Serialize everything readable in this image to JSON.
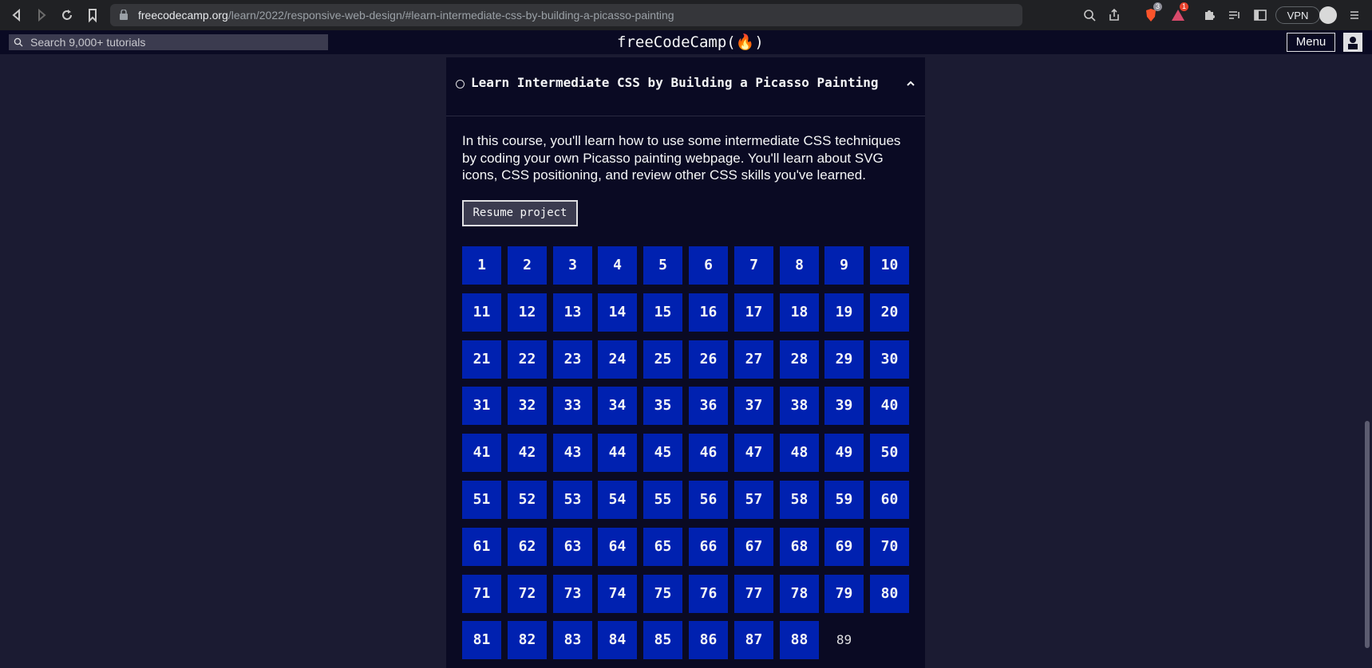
{
  "browser": {
    "url_host": "freecodecamp.org",
    "url_path": "/learn/2022/responsive-web-design/#learn-intermediate-css-by-building-a-picasso-painting",
    "brave_badge": "3",
    "alert_badge": "1",
    "vpn_label": "VPN"
  },
  "navbar": {
    "search_placeholder": "Search 9,000+ tutorials",
    "logo": "freeCodeCamp(🔥)",
    "menu_label": "Menu"
  },
  "block": {
    "title": "Learn Intermediate CSS by Building a Picasso Painting",
    "intro": "In this course, you'll learn how to use some intermediate CSS techniques by coding your own Picasso painting webpage. You'll learn about SVG icons, CSS positioning, and review other CSS skills you've learned.",
    "resume_label": "Resume project",
    "steps": [
      "1",
      "2",
      "3",
      "4",
      "5",
      "6",
      "7",
      "8",
      "9",
      "10",
      "11",
      "12",
      "13",
      "14",
      "15",
      "16",
      "17",
      "18",
      "19",
      "20",
      "21",
      "22",
      "23",
      "24",
      "25",
      "26",
      "27",
      "28",
      "29",
      "30",
      "31",
      "32",
      "33",
      "34",
      "35",
      "36",
      "37",
      "38",
      "39",
      "40",
      "41",
      "42",
      "43",
      "44",
      "45",
      "46",
      "47",
      "48",
      "49",
      "50",
      "51",
      "52",
      "53",
      "54",
      "55",
      "56",
      "57",
      "58",
      "59",
      "60",
      "61",
      "62",
      "63",
      "64",
      "65",
      "66",
      "67",
      "68",
      "69",
      "70",
      "71",
      "72",
      "73",
      "74",
      "75",
      "76",
      "77",
      "78",
      "79",
      "80",
      "81",
      "82",
      "83",
      "84",
      "85",
      "86",
      "87",
      "88",
      "89"
    ],
    "current_step": "89"
  },
  "colors": {
    "page_bg": "#1b1b32",
    "panel_bg": "#0a0a23",
    "step_bg": "#0021b0",
    "text": "#f5f6f7"
  }
}
